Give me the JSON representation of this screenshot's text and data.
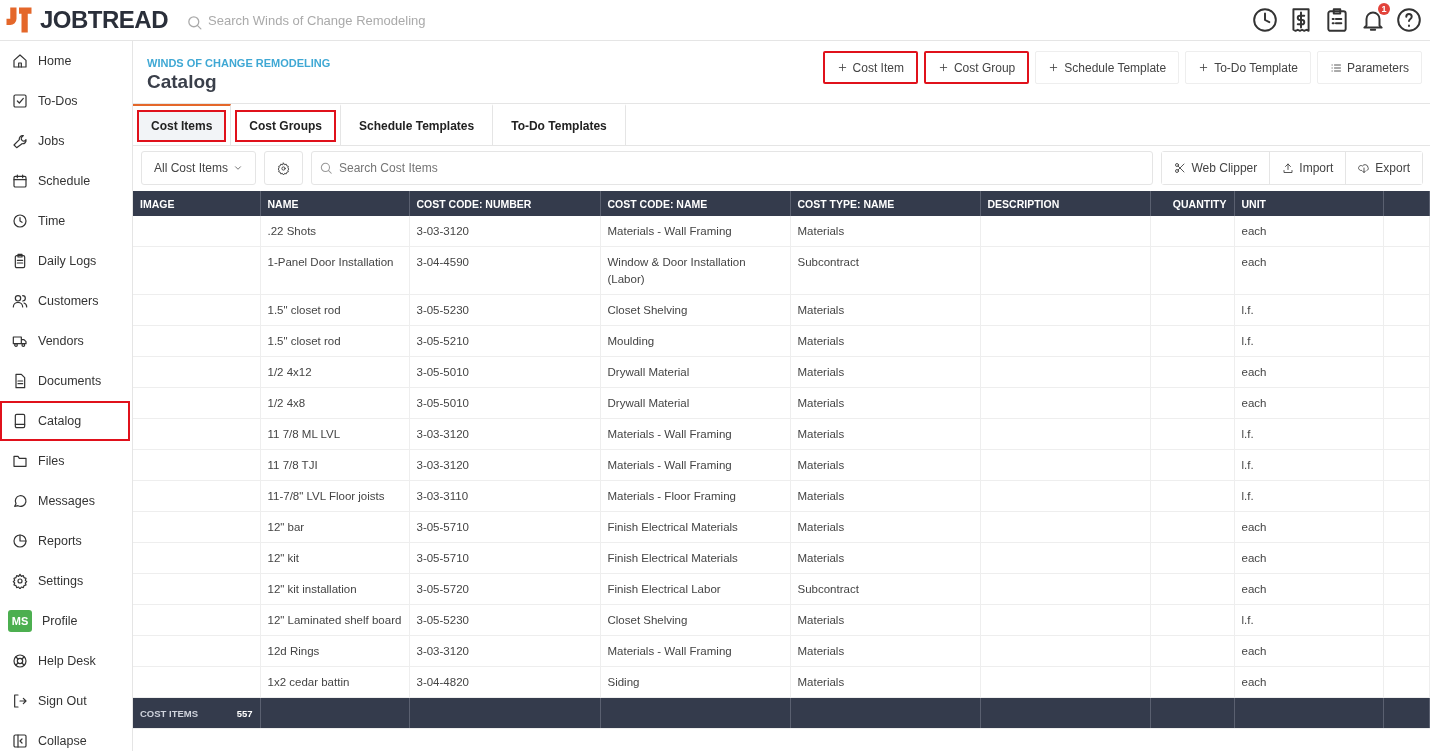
{
  "topbar": {
    "logo": "JOBTREAD",
    "search": {
      "placeholder": "Search Winds of Change Remodeling"
    },
    "notification_badge": "1"
  },
  "sidebar": {
    "items": [
      {
        "label": "Home",
        "highlighted": false
      },
      {
        "label": "To-Dos",
        "highlighted": false
      },
      {
        "label": "Jobs",
        "highlighted": false
      },
      {
        "label": "Schedule",
        "highlighted": false
      },
      {
        "label": "Time",
        "highlighted": false
      },
      {
        "label": "Daily Logs",
        "highlighted": false
      },
      {
        "label": "Customers",
        "highlighted": false
      },
      {
        "label": "Vendors",
        "highlighted": false
      },
      {
        "label": "Documents",
        "highlighted": false
      },
      {
        "label": "Catalog",
        "highlighted": true
      },
      {
        "label": "Files",
        "highlighted": false
      },
      {
        "label": "Messages",
        "highlighted": false
      },
      {
        "label": "Reports",
        "highlighted": false
      },
      {
        "label": "Settings",
        "highlighted": false
      },
      {
        "label": "Profile",
        "highlighted": false,
        "avatar": "MS"
      },
      {
        "label": "Help Desk",
        "highlighted": false
      },
      {
        "label": "Sign Out",
        "highlighted": false
      },
      {
        "label": "Collapse",
        "highlighted": false
      }
    ]
  },
  "header": {
    "organization": "WINDS OF CHANGE REMODELING",
    "title": "Catalog",
    "actions": [
      {
        "label": "Cost Item",
        "highlighted": true
      },
      {
        "label": "Cost Group",
        "highlighted": true
      },
      {
        "label": "Schedule Template",
        "highlighted": false
      },
      {
        "label": "To-Do Template",
        "highlighted": false
      },
      {
        "label": "Parameters",
        "highlighted": false
      }
    ]
  },
  "tabs": [
    {
      "label": "Cost Items",
      "selected": true,
      "highlighted": true
    },
    {
      "label": "Cost Groups",
      "selected": false,
      "highlighted": true
    },
    {
      "label": "Schedule Templates",
      "selected": false,
      "highlighted": false
    },
    {
      "label": "To-Do Templates",
      "selected": false,
      "highlighted": false
    }
  ],
  "toolbar": {
    "filter": "All Cost Items",
    "search": {
      "placeholder": "Search Cost Items"
    },
    "buttons": [
      "Web Clipper",
      "Import",
      "Export"
    ]
  },
  "table": {
    "columns": [
      "IMAGE",
      "NAME",
      "COST CODE: NUMBER",
      "COST CODE: NAME",
      "COST TYPE: NAME",
      "DESCRIPTION",
      "QUANTITY",
      "UNIT"
    ],
    "rows": [
      [
        "",
        ".22 Shots",
        "3-03-3120",
        "Materials - Wall Framing",
        "Materials",
        "",
        "",
        "each"
      ],
      [
        "",
        "1-Panel Door Installation",
        "3-04-4590",
        "Window & Door Installation (Labor)",
        "Subcontract",
        "",
        "",
        "each"
      ],
      [
        "",
        "1.5\" closet rod",
        "3-05-5230",
        "Closet Shelving",
        "Materials",
        "",
        "",
        "l.f."
      ],
      [
        "",
        "1.5\" closet rod",
        "3-05-5210",
        "Moulding",
        "Materials",
        "",
        "",
        "l.f."
      ],
      [
        "",
        "1/2 4x12",
        "3-05-5010",
        "Drywall Material",
        "Materials",
        "",
        "",
        "each"
      ],
      [
        "",
        "1/2 4x8",
        "3-05-5010",
        "Drywall Material",
        "Materials",
        "",
        "",
        "each"
      ],
      [
        "",
        "11 7/8 ML LVL",
        "3-03-3120",
        "Materials - Wall Framing",
        "Materials",
        "",
        "",
        "l.f."
      ],
      [
        "",
        "11 7/8 TJI",
        "3-03-3120",
        "Materials - Wall Framing",
        "Materials",
        "",
        "",
        "l.f."
      ],
      [
        "",
        "11-7/8\" LVL Floor joists",
        "3-03-3110",
        "Materials - Floor Framing",
        "Materials",
        "",
        "",
        "l.f."
      ],
      [
        "",
        "12\" bar",
        "3-05-5710",
        "Finish Electrical Materials",
        "Materials",
        "",
        "",
        "each"
      ],
      [
        "",
        "12\" kit",
        "3-05-5710",
        "Finish Electrical Materials",
        "Materials",
        "",
        "",
        "each"
      ],
      [
        "",
        "12\" kit installation",
        "3-05-5720",
        "Finish Electrical Labor",
        "Subcontract",
        "",
        "",
        "each"
      ],
      [
        "",
        "12\" Laminated shelf board",
        "3-05-5230",
        "Closet Shelving",
        "Materials",
        "",
        "",
        "l.f."
      ],
      [
        "",
        "12d Rings",
        "3-03-3120",
        "Materials - Wall Framing",
        "Materials",
        "",
        "",
        "each"
      ],
      [
        "",
        "1x2 cedar battin",
        "3-04-4820",
        "Siding",
        "Materials",
        "",
        "",
        "each"
      ]
    ],
    "footer": {
      "label": "COST ITEMS",
      "count": "557"
    }
  }
}
